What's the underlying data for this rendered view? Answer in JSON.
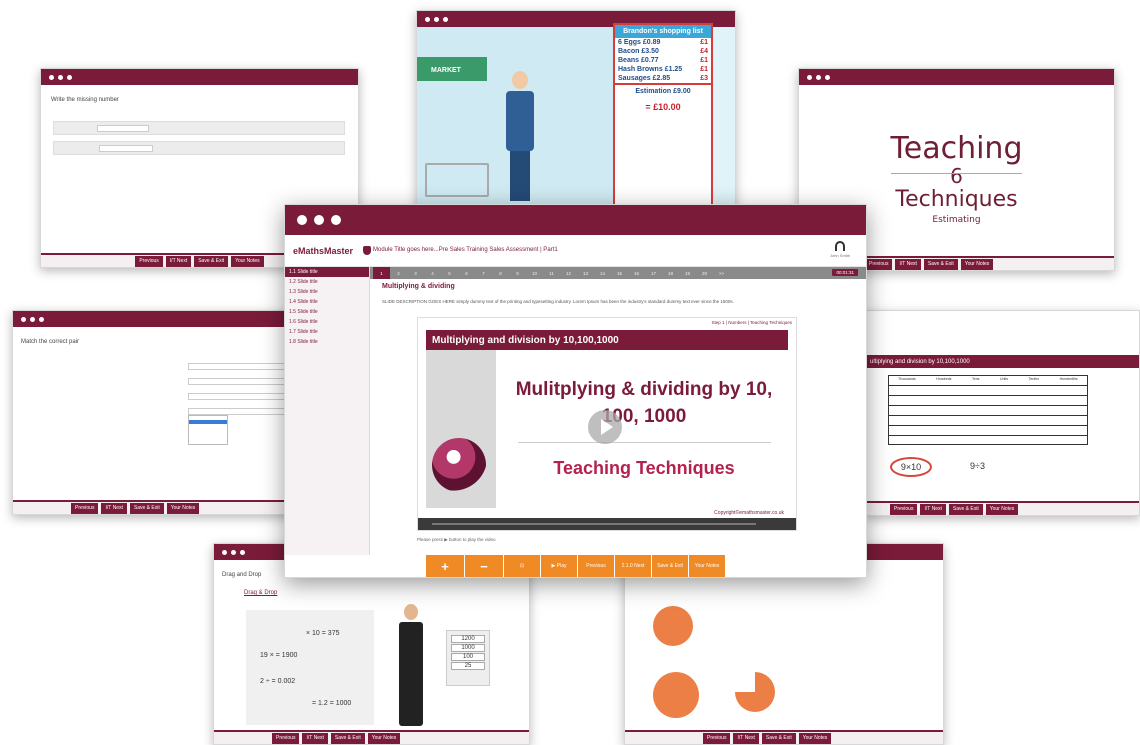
{
  "common_buttons": [
    "Previous",
    "I/T Next",
    "Save & Exit",
    "Your Notes"
  ],
  "write_window": {
    "question_text": "Write the missing number"
  },
  "shopping_window": {
    "shop_sign": "MARKET",
    "list_title": "Brandon's shopping list",
    "items": [
      {
        "name": "6 Eggs",
        "price": "£0.89",
        "rounded": "£1"
      },
      {
        "name": "Bacon",
        "price": "£3.50",
        "rounded": "£4"
      },
      {
        "name": "Beans",
        "price": "£0.77",
        "rounded": "£1"
      },
      {
        "name": "Hash Browns",
        "price": "£1.25",
        "rounded": "£1"
      },
      {
        "name": "Sausages",
        "price": "£2.85",
        "rounded": "£3"
      }
    ],
    "estimation": "Estimation £9.00",
    "total": "= £10.00"
  },
  "teaching_window": {
    "title_top": "Teaching",
    "number": "6",
    "title_bottom": "Techniques",
    "subtitle": "Estimating"
  },
  "match_window": {
    "question_text": "Match the correct pair"
  },
  "place_window": {
    "banner": "ultiplying and division by 10,100,1000",
    "headers": [
      "Thousands",
      "Hundreds",
      "Tens",
      "Units",
      "Tenths",
      "Hundredths"
    ],
    "expr1": "9×10",
    "expr2": "9÷3"
  },
  "drag_window": {
    "question_text": "Drag and Drop",
    "link": "Drag & Drop",
    "equations": [
      "× 10 = 375",
      "19 ×        = 1900",
      "2 ÷        = 0.002",
      "= 1.2 = 1000"
    ],
    "answers": [
      "1200",
      "1000",
      "100",
      "25"
    ]
  },
  "main_window": {
    "logo": "eMathsMaster",
    "module_title": "Module Title goes here...Pre Sales Training Sales Assessment | Part1",
    "user_name": "John Smith",
    "slide_numbers": [
      "1",
      "2",
      "3",
      "4",
      "5",
      "6",
      "7",
      "8",
      "9",
      "10",
      "11",
      "12",
      "13",
      "14",
      "15",
      "16",
      "17",
      "18",
      "19",
      "20",
      ">>"
    ],
    "timer": "00:01:31",
    "sidebar": [
      "1.1 Slide title",
      "1.2 Slide title",
      "1.3 Slide title",
      "1.4 Slide title",
      "1.5 Slide title",
      "1.6 Slide title",
      "1.7 Slide title",
      "1.8 Slide title"
    ],
    "content_title": "Multiplying & dividing",
    "content_desc": "SLIDE DESCRIPTION GOES HERE simply dummy text of the printing and typesetting industry. Lorem Ipsum has been the industry's standard dummy text ever since the 1500s.",
    "video": {
      "crumb": "Step 1 | Numbers | Teaching Techniques",
      "banner": "Multiplying and division by 10,100,1000",
      "heading": "Mulitplying & dividing by 10, 100, 1000",
      "subheading": "Teaching Techniques",
      "copyright": "Copyright©emathsmaster.co.uk"
    },
    "press_note": "Please press ▶ button to play the video",
    "toolbar": [
      "+",
      "−",
      "⊡",
      "▶ Play",
      "Previous",
      "2.1.0 Next",
      "Save & Exit",
      "Your Notes"
    ]
  }
}
